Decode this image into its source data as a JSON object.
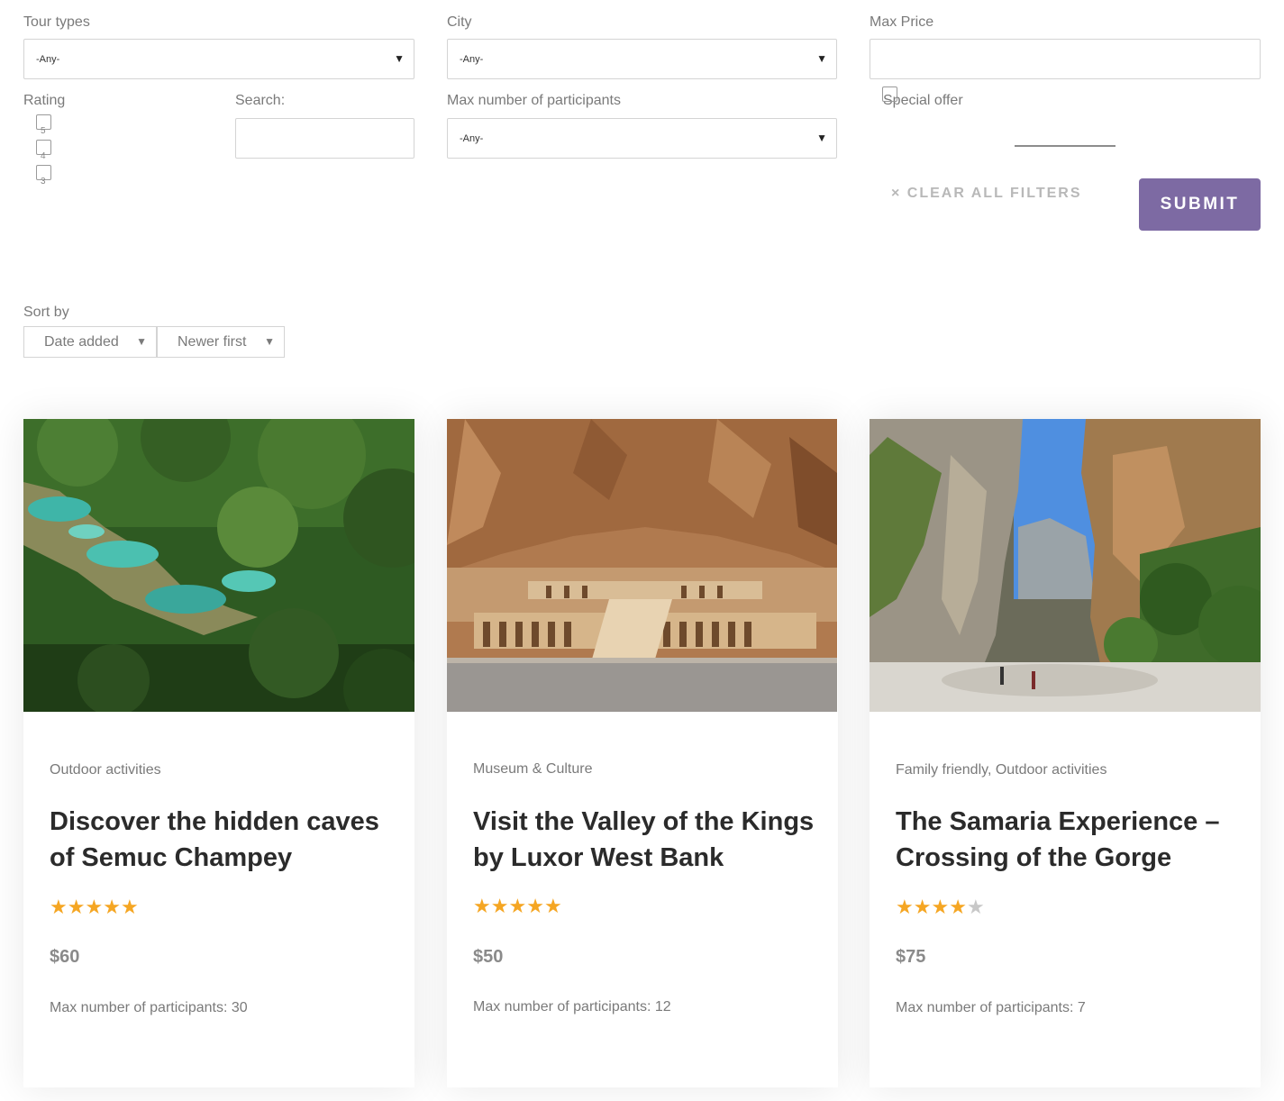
{
  "filters": {
    "tour_types": {
      "label": "Tour types",
      "value": "-Any-"
    },
    "city": {
      "label": "City",
      "value": "-Any-"
    },
    "max_price": {
      "label": "Max Price",
      "value": ""
    },
    "rating": {
      "label": "Rating",
      "options": [
        "5",
        "4",
        "3"
      ]
    },
    "search": {
      "label": "Search:",
      "value": ""
    },
    "max_participants": {
      "label": "Max number of participants",
      "value": "-Any-"
    },
    "special_offer": {
      "label": "Special offer"
    },
    "clear_label": "× CLEAR ALL FILTERS",
    "submit_label": "SUBMIT"
  },
  "sort": {
    "label": "Sort by",
    "field": "Date added",
    "order": "Newer first"
  },
  "tours": [
    {
      "category": "Outdoor activities",
      "title": "Discover the hidden caves of Semuc Champey",
      "rating": 5,
      "price": "$60",
      "max_participants": "Max number of participants: 30",
      "image": "jungle-pools-photo"
    },
    {
      "category": "Museum & Culture",
      "title": "Visit the Valley of the Kings by Luxor West Bank",
      "rating": 5,
      "price": "$50",
      "max_participants": "Max number of participants: 12",
      "image": "temple-photo"
    },
    {
      "category": "Family friendly, Outdoor activities",
      "title": "The Samaria Experience – Crossing of the Gorge",
      "rating": 4,
      "price": "$75",
      "max_participants": "Max number of participants: 7",
      "image": "gorge-photo"
    }
  ],
  "colors": {
    "accent": "#7d6aa3",
    "star": "#f5a623",
    "star_off": "#c8c8c8"
  }
}
